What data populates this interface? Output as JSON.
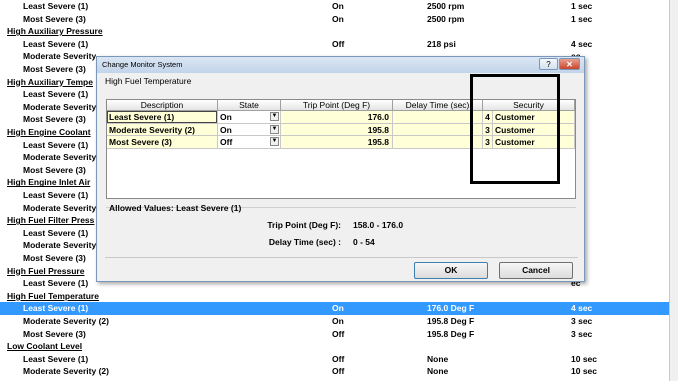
{
  "background_list": [
    {
      "type": "item",
      "name": "Least Severe (1)",
      "state": "On",
      "value": "2500 rpm",
      "time": "1 sec"
    },
    {
      "type": "item",
      "name": "Most Severe (3)",
      "state": "On",
      "value": "2500 rpm",
      "time": "1 sec"
    },
    {
      "type": "group",
      "name": "High Auxiliary Pressure"
    },
    {
      "type": "item",
      "name": "Least Severe (1)",
      "state": "Off",
      "value": "218 psi",
      "time": "4 sec"
    },
    {
      "type": "item",
      "name": "Moderate Severity",
      "state": "",
      "value": "",
      "time": "ec"
    },
    {
      "type": "item",
      "name": "Most Severe (3)",
      "state": "",
      "value": "",
      "time": "ec"
    },
    {
      "type": "group",
      "name": "High Auxiliary Tempe"
    },
    {
      "type": "item",
      "name": "Least Severe (1)",
      "state": "",
      "value": "",
      "time": "ec"
    },
    {
      "type": "item",
      "name": "Moderate Severity",
      "state": "",
      "value": "",
      "time": "ec"
    },
    {
      "type": "item",
      "name": "Most Severe (3)",
      "state": "",
      "value": "",
      "time": "ec"
    },
    {
      "type": "group",
      "name": "High Engine Coolant"
    },
    {
      "type": "item",
      "name": "Least Severe (1)",
      "state": "",
      "value": "",
      "time": "ec"
    },
    {
      "type": "item",
      "name": "Moderate Severity",
      "state": "",
      "value": "",
      "time": "ec"
    },
    {
      "type": "item",
      "name": "Most Severe (3)",
      "state": "",
      "value": "",
      "time": "ec"
    },
    {
      "type": "group",
      "name": "High Engine Inlet Air"
    },
    {
      "type": "item",
      "name": "Least Severe (1)",
      "state": "",
      "value": "",
      "time": "ec"
    },
    {
      "type": "item",
      "name": "Moderate Severity",
      "state": "",
      "value": "",
      "time": "ec"
    },
    {
      "type": "group",
      "name": "High Fuel Filter Press"
    },
    {
      "type": "item",
      "name": "Least Severe (1)",
      "state": "",
      "value": "",
      "time": "sec"
    },
    {
      "type": "item",
      "name": "Moderate Severity",
      "state": "",
      "value": "",
      "time": "sec"
    },
    {
      "type": "item",
      "name": "Most Severe (3)",
      "state": "",
      "value": "",
      "time": "sec"
    },
    {
      "type": "group",
      "name": "High Fuel Pressure"
    },
    {
      "type": "item",
      "name": "Least Severe (1)",
      "state": "",
      "value": "",
      "time": "ec"
    },
    {
      "type": "group",
      "name": "High Fuel Temperature"
    },
    {
      "type": "item",
      "name": "Least Severe (1)",
      "state": "On",
      "value": "176.0 Deg F",
      "time": "4 sec",
      "selected": true
    },
    {
      "type": "item",
      "name": "Moderate Severity (2)",
      "state": "On",
      "value": "195.8 Deg F",
      "time": "3 sec"
    },
    {
      "type": "item",
      "name": "Most Severe (3)",
      "state": "Off",
      "value": "195.8 Deg F",
      "time": "3 sec"
    },
    {
      "type": "group",
      "name": "Low Coolant Level"
    },
    {
      "type": "item",
      "name": "Least Severe (1)",
      "state": "Off",
      "value": "None",
      "time": "10 sec"
    },
    {
      "type": "item",
      "name": "Moderate Severity (2)",
      "state": "Off",
      "value": "None",
      "time": "10 sec"
    }
  ],
  "dialog": {
    "title": "Change Monitor System",
    "help_label": "?",
    "close_label": "✕",
    "header": "High Fuel Temperature",
    "columns": [
      "Description",
      "State",
      "Trip Point (Deg F)",
      "Delay Time (sec)",
      "Security"
    ],
    "rows": [
      {
        "description": "Least Severe (1)",
        "state": "On",
        "trip": "176.0",
        "delay": "",
        "level": "4",
        "security": "Customer"
      },
      {
        "description": "Moderate Severity (2)",
        "state": "On",
        "trip": "195.8",
        "delay": "",
        "level": "3",
        "security": "Customer"
      },
      {
        "description": "Most Severe (3)",
        "state": "Off",
        "trip": "195.8",
        "delay": "",
        "level": "3",
        "security": "Customer"
      }
    ],
    "allowed_values_title": "Allowed Values: Least Severe (1)",
    "trip_label": "Trip Point (Deg F):",
    "trip_range": "158.0 - 176.0",
    "delay_label": "Delay Time (sec) :",
    "delay_range": "0 - 54",
    "ok_label": "OK",
    "cancel_label": "Cancel",
    "dropdown_glyph": "▼"
  }
}
